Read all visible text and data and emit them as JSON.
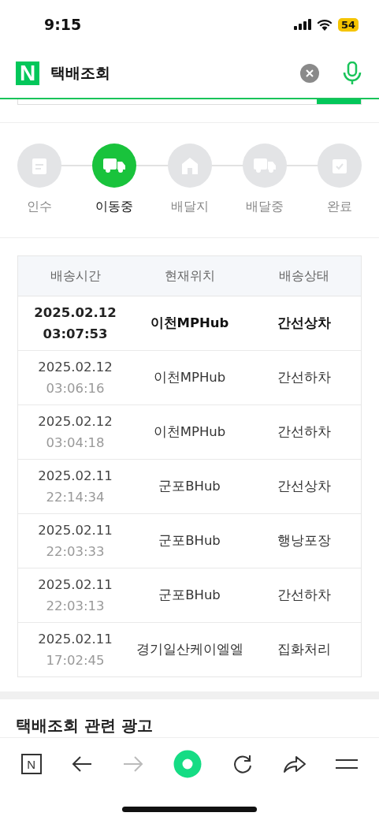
{
  "status_bar": {
    "time": "9:15",
    "battery": "54"
  },
  "search_bar": {
    "logo": "N",
    "query": "택배조회"
  },
  "steps": [
    {
      "label": "인수",
      "selected": false
    },
    {
      "label": "이동중",
      "selected": true
    },
    {
      "label": "배달지",
      "selected": false
    },
    {
      "label": "배달중",
      "selected": false
    },
    {
      "label": "완료",
      "selected": false
    }
  ],
  "table": {
    "columns": [
      "배송시간",
      "현재위치",
      "배송상태"
    ],
    "rows": [
      {
        "date": "2025.02.12",
        "time": "03:07:53",
        "location": "이천MPHub",
        "status": "간선상차",
        "current": true
      },
      {
        "date": "2025.02.12",
        "time": "03:06:16",
        "location": "이천MPHub",
        "status": "간선하차",
        "current": false
      },
      {
        "date": "2025.02.12",
        "time": "03:04:18",
        "location": "이천MPHub",
        "status": "간선하차",
        "current": false
      },
      {
        "date": "2025.02.11",
        "time": "22:14:34",
        "location": "군포BHub",
        "status": "간선상차",
        "current": false
      },
      {
        "date": "2025.02.11",
        "time": "22:03:33",
        "location": "군포BHub",
        "status": "행낭포장",
        "current": false
      },
      {
        "date": "2025.02.11",
        "time": "22:03:13",
        "location": "군포BHub",
        "status": "간선하차",
        "current": false
      },
      {
        "date": "2025.02.11",
        "time": "17:02:45",
        "location": "경기일산케이엘엘",
        "status": "집화처리",
        "current": false
      }
    ]
  },
  "ad_section": {
    "title": "택배조회 관련 광고"
  },
  "toolbar": {
    "home_label": "N",
    "forward_disabled": true
  }
}
